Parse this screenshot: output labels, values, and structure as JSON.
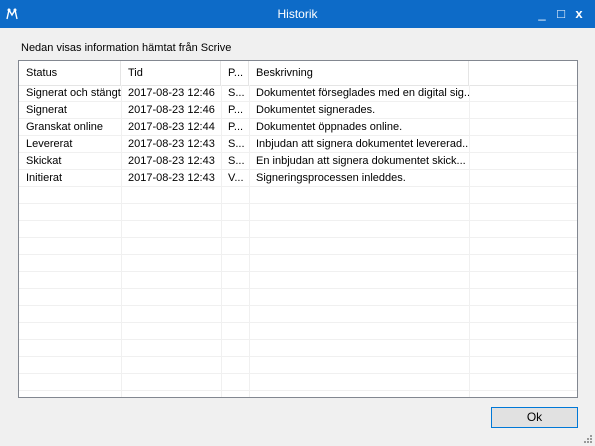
{
  "window": {
    "title": "Historik",
    "minimize": "_",
    "maximize": "□",
    "close": "x"
  },
  "intro": "Nedan visas information hämtat från Scrive",
  "columns": [
    "Status",
    "Tid",
    "P...",
    "Beskrivning",
    ""
  ],
  "rows": [
    [
      "Signerat och stängt",
      "2017-08-23 12:46",
      "S...",
      "Dokumentet förseglades med en digital sig..."
    ],
    [
      "Signerat",
      "2017-08-23 12:46",
      "P...",
      "Dokumentet signerades."
    ],
    [
      "Granskat online",
      "2017-08-23 12:44",
      "P...",
      "Dokumentet öppnades online."
    ],
    [
      "Levererat",
      "2017-08-23 12:43",
      "S...",
      "Inbjudan att signera dokumentet levererad..."
    ],
    [
      "Skickat",
      "2017-08-23 12:43",
      "S...",
      "En inbjudan att signera dokumentet skick..."
    ],
    [
      "Initierat",
      "2017-08-23 12:43",
      "V...",
      "Signeringsprocessen inleddes."
    ]
  ],
  "ok_label": "Ok",
  "colors": {
    "titlebar": "#0d6bc8",
    "button_border": "#0078d7"
  }
}
